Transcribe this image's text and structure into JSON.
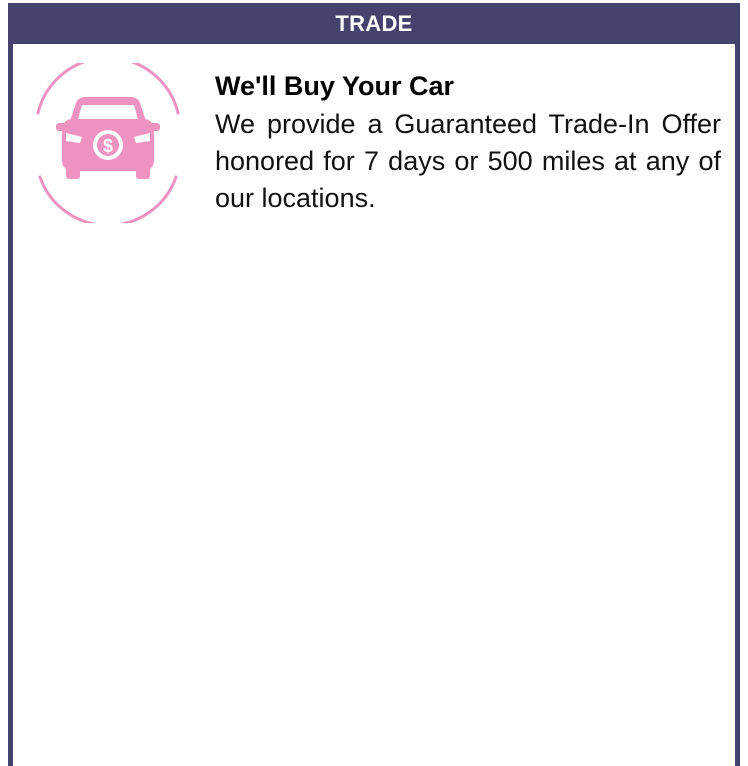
{
  "header": {
    "title": "TRADE"
  },
  "feature": {
    "icon": "car-dollar-icon",
    "title": "We'll Buy Your Car",
    "description": "We provide a Guaranteed Trade-In Offer honored for 7 days or 500 miles at any of our locations."
  },
  "colors": {
    "header_bg": "#46426e",
    "icon_pink": "#ee93c0"
  }
}
